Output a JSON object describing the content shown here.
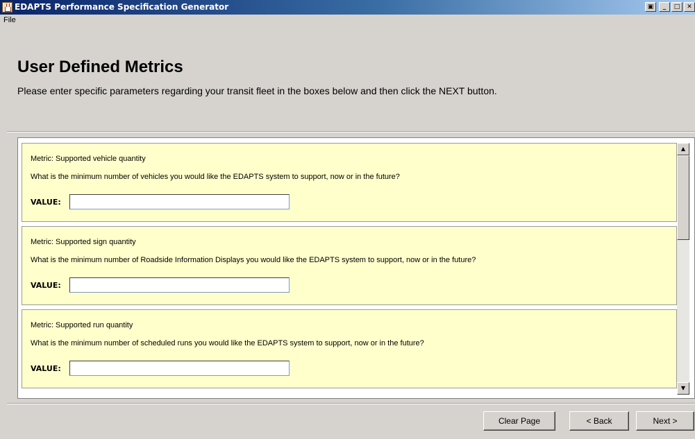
{
  "window": {
    "title": "EDAPTS Performance Specification Generator",
    "controls": [
      "restore-icon",
      "minimize-icon",
      "maximize-icon",
      "close-icon"
    ]
  },
  "menu": {
    "file_label": "File"
  },
  "header": {
    "title": "User Defined Metrics",
    "description": "Please enter specific parameters regarding your transit fleet in the boxes below and then click the NEXT button."
  },
  "metrics": [
    {
      "metric": "Metric: Supported vehicle quantity",
      "question": "What is the minimum number of vehicles you would like the EDAPTS system to support, now or in the future?",
      "value_label": "VALUE:",
      "value": ""
    },
    {
      "metric": "Metric: Supported sign quantity",
      "question": "What is the minimum number of Roadside Information Displays you would like the EDAPTS system to support, now or in the future?",
      "value_label": "VALUE:",
      "value": ""
    },
    {
      "metric": "Metric: Supported run quantity",
      "question": "What is the minimum number of scheduled runs you would like the EDAPTS system to support, now or in the future?",
      "value_label": "VALUE:",
      "value": ""
    }
  ],
  "buttons": {
    "clear": "Clear Page",
    "back": "< Back",
    "next": "Next >"
  },
  "colors": {
    "card_background": "#ffffcc",
    "window_background": "#d6d3ce",
    "titlebar_start": "#0a246a"
  }
}
